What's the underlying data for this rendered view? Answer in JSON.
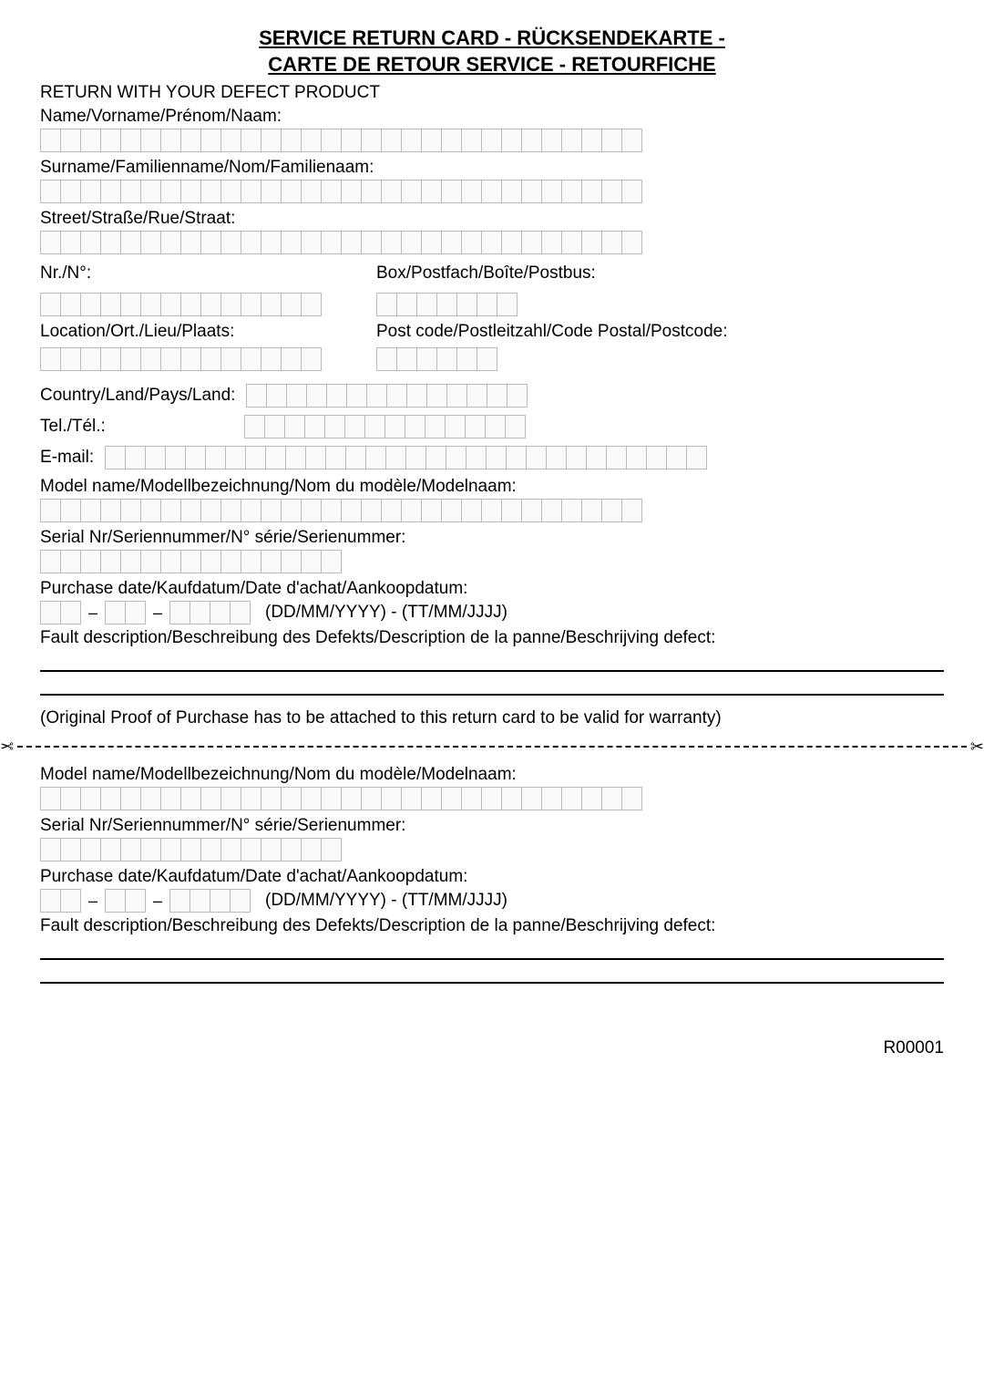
{
  "title_line1": "SERVICE RETURN CARD - RÜCKSENDEKARTE -",
  "title_line2": "CARTE DE RETOUR SERVICE - RETOURFICHE",
  "return_with": "RETURN WITH YOUR DEFECT PRODUCT",
  "labels": {
    "name": "Name/Vorname/Prénom/Naam:",
    "surname": "Surname/Familienname/Nom/Familienaam:",
    "street": "Street/Straße/Rue/Straat:",
    "nr": "Nr./N°:",
    "box": "Box/Postfach/Boîte/Postbus:",
    "location": "Location/Ort./Lieu/Plaats:",
    "postcode": "Post code/Postleitzahl/Code Postal/Postcode:",
    "country": "Country/Land/Pays/Land:",
    "tel": "Tel./Tél.:",
    "email": "E-mail:",
    "model": "Model name/Modellbezeichnung/Nom du modèle/Modelnaam:",
    "serial": "Serial Nr/Seriennummer/N° série/Serienummer:",
    "purchase": "Purchase date/Kaufdatum/Date d'achat/Aankoopdatum:",
    "date_hint": "(DD/MM/YYYY) - (TT/MM/JJJJ)",
    "fault": "Fault description/Beschreibung des Defekts/Description de la panne/Beschrijving defect:",
    "proof": "(Original Proof of Purchase has to be attached to this return card to be valid for warranty)"
  },
  "cell_counts": {
    "name": 30,
    "surname": 30,
    "street": 30,
    "nr": 14,
    "box": 7,
    "location": 14,
    "postcode": 6,
    "country": 14,
    "tel": 14,
    "email": 30,
    "model": 30,
    "serial": 15,
    "d": 2,
    "m": 2,
    "y": 4
  },
  "footer": "R00001"
}
